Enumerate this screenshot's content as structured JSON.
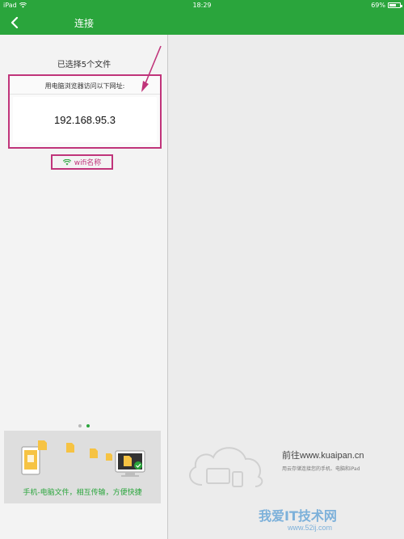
{
  "status_bar": {
    "device": "iPad",
    "time": "18:29",
    "battery_text": "69%",
    "battery_level": 0.69
  },
  "nav": {
    "title": "连接"
  },
  "connect": {
    "selected_text": "已选择5个文件",
    "instruction": "用电脑浏览器访问以下网址:",
    "address": "192.168.95.3",
    "wifi_label": "wifi名称"
  },
  "pager": {
    "count": 2,
    "active": 1
  },
  "banner": {
    "caption": "手机-电脑文件，相互传输，方便快捷"
  },
  "right_panel": {
    "headline": "前往www.kuaipan.cn",
    "subline": "用云存储连接您的手机、电脑和iPad"
  },
  "watermark": {
    "text": "我爱IT技术网",
    "url": "www.52ij.com"
  },
  "colors": {
    "green": "#2aa53c",
    "magenta": "#c0347a"
  }
}
